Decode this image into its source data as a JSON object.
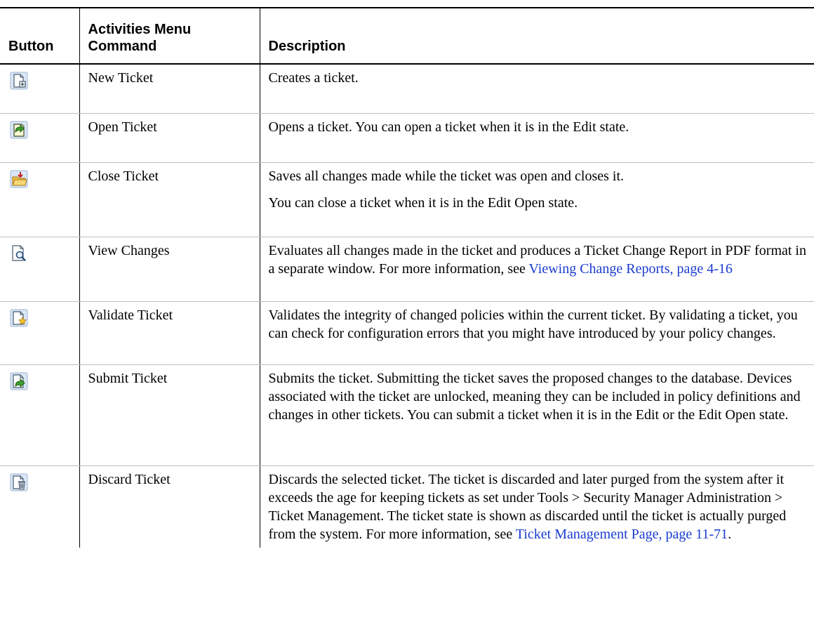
{
  "header": {
    "button": "Button",
    "command": "Activities Menu Command",
    "description": "Description"
  },
  "rows": [
    {
      "icon": "new-ticket-icon",
      "command": "New Ticket",
      "description": [
        "Creates a ticket."
      ]
    },
    {
      "icon": "open-ticket-icon",
      "command": "Open Ticket",
      "description": [
        "Opens a ticket. You can open a ticket when it is in the Edit state."
      ]
    },
    {
      "icon": "close-ticket-icon",
      "command": "Close Ticket",
      "description": [
        "Saves all changes made while the ticket was open and closes it.",
        "You can close a ticket when it is in the Edit Open state."
      ]
    },
    {
      "icon": "view-changes-icon",
      "command": "View Changes",
      "description_text": "Evaluates all changes made in the ticket and produces a Ticket Change Report in PDF format in a separate window. For more information, see ",
      "link": "Viewing Change Reports, page 4-16"
    },
    {
      "icon": "validate-ticket-icon",
      "command": "Validate Ticket",
      "description": [
        "Validates the integrity of changed policies within the current ticket. By validating a ticket, you can check for configuration errors that you might have introduced by your policy changes."
      ]
    },
    {
      "icon": "submit-ticket-icon",
      "command": "Submit Ticket",
      "description": [
        "Submits the ticket. Submitting the ticket saves the proposed changes to the database. Devices associated with the ticket are unlocked, meaning they can be included in policy definitions and changes in other tickets. You can submit a ticket when it is in the Edit or the Edit Open state."
      ]
    },
    {
      "icon": "discard-ticket-icon",
      "command": "Discard Ticket",
      "description_text": "Discards the selected ticket. The ticket is discarded and later purged from the system after it exceeds the age for keeping tickets as set under Tools > Security Manager Administration > Ticket Management. The ticket state is shown as discarded until the ticket is actually purged from the system. For more information, see ",
      "link": "Ticket Management Page, page 11-71",
      "description_tail": "."
    }
  ]
}
